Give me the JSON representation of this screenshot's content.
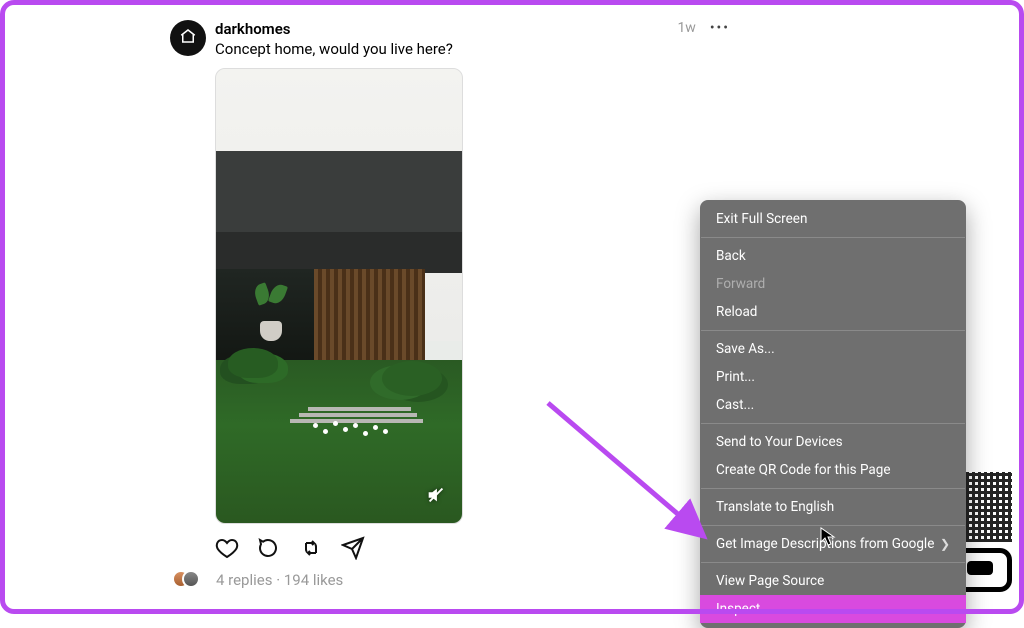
{
  "post": {
    "username": "darkhomes",
    "caption": "Concept home, would you live here?",
    "timestamp": "1w",
    "avatar_icon": "house-icon",
    "mute_icon": "speaker-muted-icon",
    "replies_label": "4 replies",
    "likes_label": "194 likes",
    "meta_separator": " · "
  },
  "actions": {
    "like": "heart-icon",
    "comment": "comment-icon",
    "repost": "repost-icon",
    "share": "send-icon"
  },
  "context_menu": {
    "items": [
      {
        "label": "Exit Full Screen",
        "enabled": true
      },
      {
        "separator": true
      },
      {
        "label": "Back",
        "enabled": true
      },
      {
        "label": "Forward",
        "enabled": false
      },
      {
        "label": "Reload",
        "enabled": true
      },
      {
        "separator": true
      },
      {
        "label": "Save As...",
        "enabled": true
      },
      {
        "label": "Print...",
        "enabled": true
      },
      {
        "label": "Cast...",
        "enabled": true
      },
      {
        "separator": true
      },
      {
        "label": "Send to Your Devices",
        "enabled": true
      },
      {
        "label": "Create QR Code for this Page",
        "enabled": true
      },
      {
        "separator": true
      },
      {
        "label": "Translate to English",
        "enabled": true
      },
      {
        "separator": true
      },
      {
        "label": "Get Image Descriptions from Google",
        "enabled": true,
        "submenu": true
      },
      {
        "separator": true
      },
      {
        "label": "View Page Source",
        "enabled": true
      },
      {
        "label": "Inspect",
        "enabled": true,
        "highlighted": true
      }
    ]
  },
  "annotation": {
    "arrow_color": "#b94af0"
  }
}
